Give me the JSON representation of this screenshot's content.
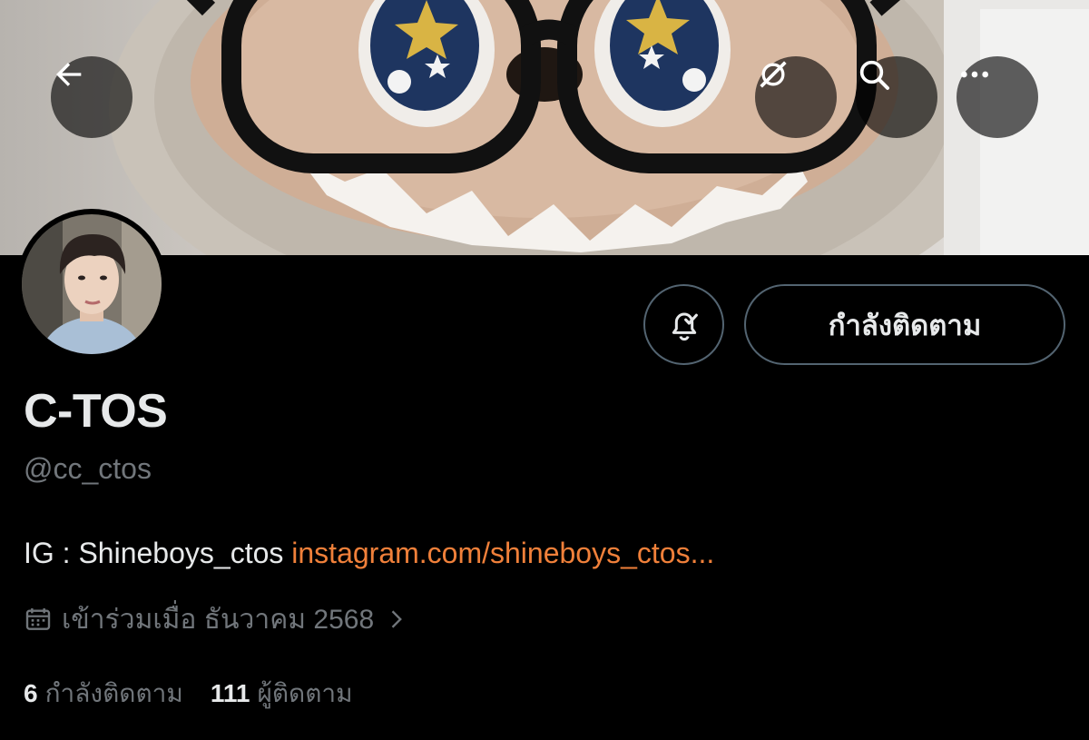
{
  "header": {
    "back_icon": "arrow-left-icon",
    "actions": [
      "grok-icon",
      "search-icon",
      "more-icon"
    ]
  },
  "profile": {
    "display_name": "C-TOS",
    "handle": "@cc_ctos",
    "bio_text": "IG : Shineboys_ctos ",
    "bio_link": "instagram.com/shineboys_ctos...",
    "joined": "เข้าร่วมเมื่อ ธันวาคม 2568",
    "following_label": "กำลังติดตาม",
    "notification_icon": "bell-check-icon"
  },
  "stats": {
    "following_count": "6",
    "following_label": "กำลังติดตาม",
    "followers_count": "111",
    "followers_label": "ผู้ติดตาม"
  },
  "colors": {
    "background": "#000000",
    "text": "#e7e9ea",
    "muted": "#71767b",
    "border": "#536471",
    "link": "#f0803a"
  }
}
